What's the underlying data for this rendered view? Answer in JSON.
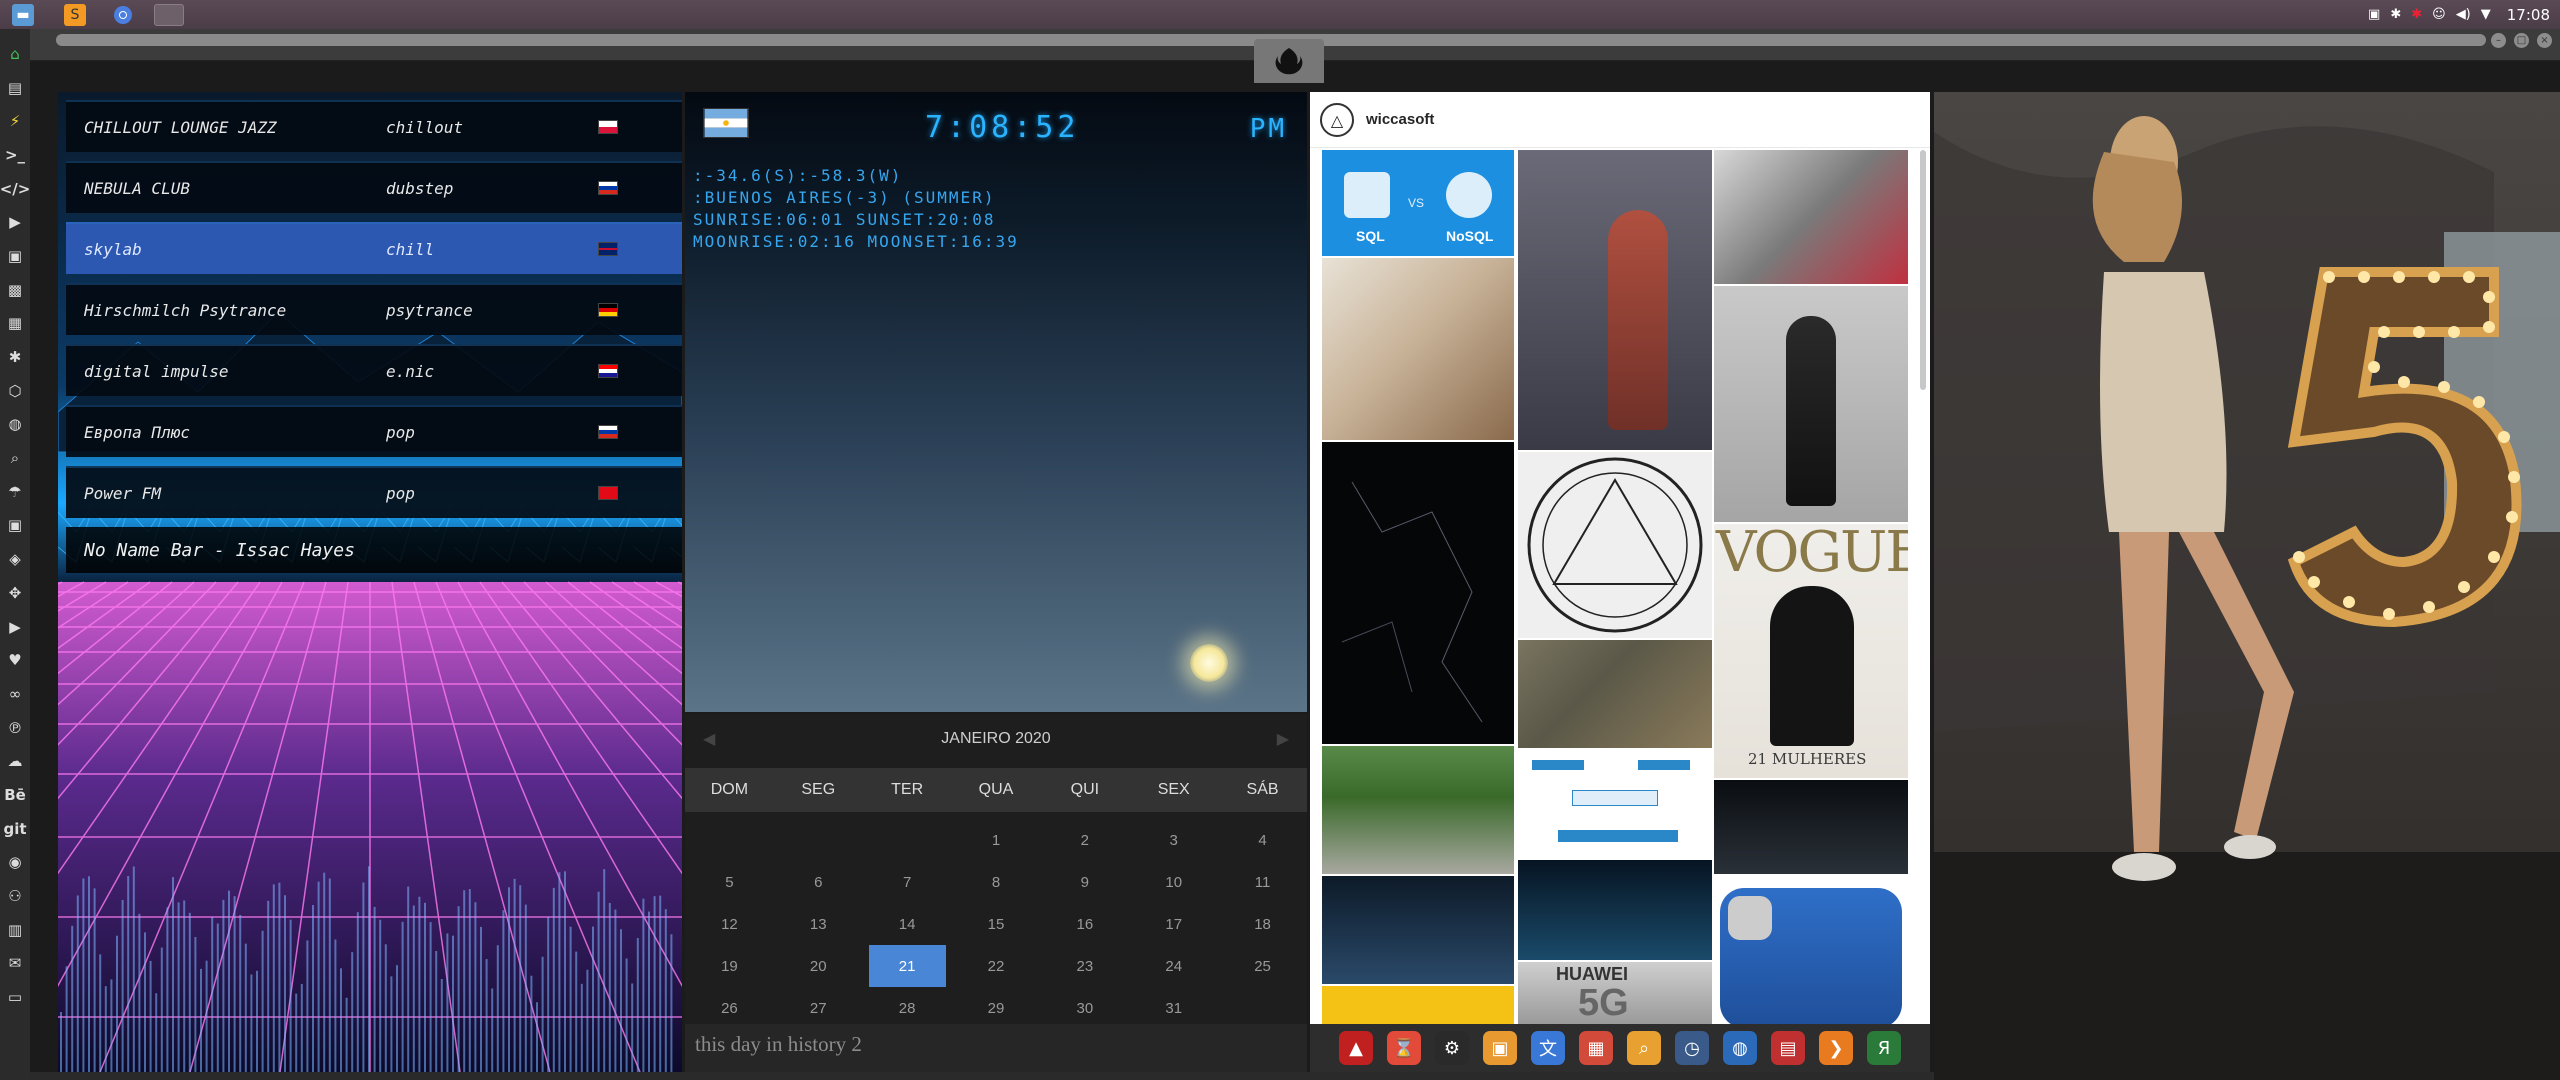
{
  "topbar": {
    "apps": [
      "files-icon",
      "sublime-icon",
      "chrome-icon",
      "window-icon"
    ],
    "time": "17:08"
  },
  "sidebar": {
    "items": [
      {
        "icon": "home-icon",
        "glyph": "⌂"
      },
      {
        "icon": "document-icon",
        "glyph": "▤"
      },
      {
        "icon": "bolt-icon",
        "glyph": "⚡"
      },
      {
        "icon": "terminal-icon",
        "glyph": ">_"
      },
      {
        "icon": "code-icon",
        "glyph": "</>"
      },
      {
        "icon": "play-icon",
        "glyph": "▶"
      },
      {
        "icon": "video-icon",
        "glyph": "▣"
      },
      {
        "icon": "image-icon",
        "glyph": "▩"
      },
      {
        "icon": "news-icon",
        "glyph": "▦"
      },
      {
        "icon": "settings-icon",
        "glyph": "✱"
      },
      {
        "icon": "hexagon-icon",
        "glyph": "⬡"
      },
      {
        "icon": "globe-icon",
        "glyph": "◍"
      },
      {
        "icon": "search-icon",
        "glyph": "⌕"
      },
      {
        "icon": "umbrella-icon",
        "glyph": "☂"
      },
      {
        "icon": "contact-icon",
        "glyph": "▣"
      },
      {
        "icon": "tag-icon",
        "glyph": "◈"
      },
      {
        "icon": "expand-icon",
        "glyph": "✥"
      },
      {
        "icon": "youtube-icon",
        "glyph": "▶"
      },
      {
        "icon": "heart-icon",
        "glyph": "♥"
      },
      {
        "icon": "infinity-icon",
        "glyph": "∞"
      },
      {
        "icon": "pinterest-icon",
        "glyph": "℗"
      },
      {
        "icon": "cloud-icon",
        "glyph": "☁"
      },
      {
        "icon": "behance-icon",
        "glyph": "Bē"
      },
      {
        "icon": "git-icon",
        "glyph": "git"
      },
      {
        "icon": "github-icon",
        "glyph": "◉"
      },
      {
        "icon": "people-icon",
        "glyph": "⚇"
      },
      {
        "icon": "map-icon",
        "glyph": "▥"
      },
      {
        "icon": "mail-icon",
        "glyph": "✉"
      },
      {
        "icon": "monitor-icon",
        "glyph": "▭"
      }
    ]
  },
  "radio": {
    "stations": [
      {
        "name": "CHILLOUT LOUNGE JAZZ",
        "genre": "chillout",
        "flag": "poland"
      },
      {
        "name": "NEBULA CLUB",
        "genre": "dubstep",
        "flag": "russia"
      },
      {
        "name": "skylab",
        "genre": "chill",
        "flag": "uk"
      },
      {
        "name": "Hirschmilch Psytrance",
        "genre": "psytrance",
        "flag": "germany"
      },
      {
        "name": "digital impulse",
        "genre": "e.nic",
        "flag": "croatia"
      },
      {
        "name": "Европа Плюс",
        "genre": "pop",
        "flag": "russia"
      },
      {
        "name": "Power FM",
        "genre": "pop",
        "flag": "turkey"
      }
    ],
    "now_playing": "No Name Bar - Issac Hayes"
  },
  "weather": {
    "time": "7:08:52",
    "ampm": "PM",
    "coords": ":-34.6(S):-58.3(W)",
    "location": ":BUENOS AIRES(-3) (SUMMER)",
    "sun": "SUNRISE:06:01 SUNSET:20:08",
    "moon": "MOONRISE:02:16 MOONSET:16:39"
  },
  "calendar": {
    "month": "JANEIRO 2020",
    "days": [
      "DOM",
      "SEG",
      "TER",
      "QUA",
      "QUI",
      "SEX",
      "SÁB"
    ],
    "cells": [
      "",
      "",
      "",
      "1",
      "2",
      "3",
      "4",
      "5",
      "6",
      "7",
      "8",
      "9",
      "10",
      "11",
      "12",
      "13",
      "14",
      "15",
      "16",
      "17",
      "18",
      "19",
      "20",
      "21",
      "22",
      "23",
      "24",
      "25",
      "26",
      "27",
      "28",
      "29",
      "30",
      "31",
      ""
    ],
    "today": "21"
  },
  "history": {
    "text": "this day in history 2"
  },
  "instagram": {
    "username": "wiccasoft",
    "sql": {
      "left": "SQL",
      "vs": "VS",
      "right": "NoSQL"
    },
    "magazine": "VOGUE",
    "magazine_sub": "21 MULHERES",
    "phone_brand": "HUAWEI",
    "phone_label": "5G"
  },
  "dock": {
    "apps": [
      "acrobat-icon",
      "hourglass-icon",
      "ubuntu-icon",
      "photos-icon",
      "translate-icon",
      "calendar-icon",
      "search-icon",
      "clock-icon",
      "globe-icon",
      "calendar-icon",
      "arrow-icon",
      "yandex-icon"
    ]
  },
  "colors": {
    "accent_blue": "#2ab3ff",
    "selected_station": "#2c58b2",
    "today": "#4a86d6"
  }
}
